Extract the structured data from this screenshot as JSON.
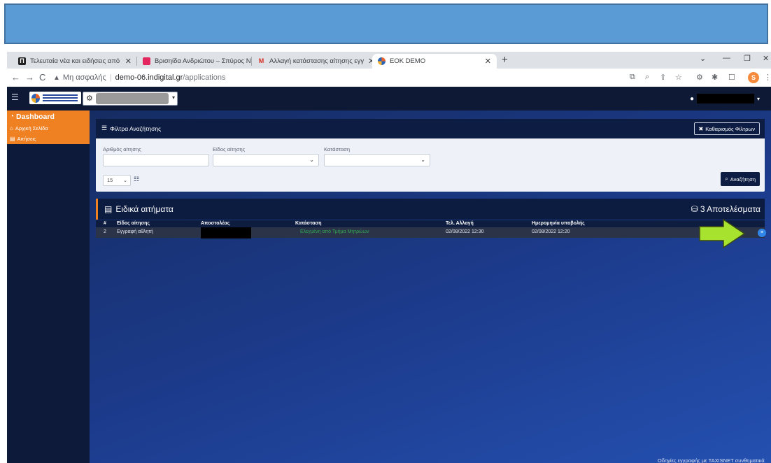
{
  "browser": {
    "tabs": [
      {
        "title": "Τελευταία νέα και ειδήσεις από",
        "favicon": "news-favicon",
        "active": false
      },
      {
        "title": "Βρισηίδα Ανδριώτου – Σπύρος Ν",
        "favicon": "music-favicon",
        "active": false
      },
      {
        "title": "Αλλαγή κατάστασης αίτησης εγγ",
        "favicon": "gmail-favicon",
        "active": false
      },
      {
        "title": "EOK DEMO",
        "favicon": "eok-favicon",
        "active": true
      }
    ],
    "new_tab": "+",
    "url": {
      "warning": "Μη ασφαλής",
      "host": "demo-06.indigital.gr",
      "path": "/applications"
    },
    "profile_letter": "S"
  },
  "sidebar": {
    "items": [
      {
        "label": "Dashboard"
      },
      {
        "label": "Αρχική Σελίδα"
      },
      {
        "label": "Αιτήσεις"
      }
    ]
  },
  "filters": {
    "title": "Φίλτρα Αναζήτησης",
    "clear_label": "Καθαρισμός Φίλτρων",
    "field_number_label": "Αριθμός αίτησης",
    "field_type_label": "Είδος αίτησης",
    "field_status_label": "Κατάσταση",
    "page_size": "15",
    "search_label": "Αναζήτηση"
  },
  "results": {
    "title": "Ειδικά αιτήματα",
    "count_label": "3 Αποτελέσματα",
    "columns": {
      "num": "#",
      "type": "Είδος αίτησης",
      "sender": "Αποστολέας",
      "status": "Κατάσταση",
      "last_change": "Τελ. Αλλαγή",
      "submitted": "Ημερομηνία υποβολής"
    },
    "rows": [
      {
        "num": "2",
        "type": "Εγγραφή αθλητή",
        "status": "Ελεγμένη από Τμήμα Μητρώων",
        "last_change": "02/08/2022 12:30",
        "submitted": "02/08/2022 12:20"
      }
    ]
  },
  "footer": {
    "link": "Οδηγίες εγγραφής με TAXISNET συνθηματικά"
  },
  "colors": {
    "accent": "#f08123",
    "header": "#0c1c42",
    "status_green": "#34a853",
    "action_blue": "#2f86e8",
    "arrow": "#a6e22e"
  }
}
